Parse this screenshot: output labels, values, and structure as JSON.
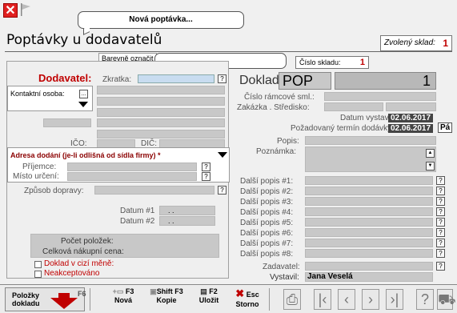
{
  "top": {
    "new_request_callout": "Nová poptávka..."
  },
  "page_title": "Poptávky u dodavatelů",
  "sklad_label": "Zvolený sklad:",
  "sklad_value": "1",
  "barevne_oznacit": "Barevně označit",
  "cislo_skladu_label": "Číslo skladu:",
  "cislo_skladu_value": "1",
  "left": {
    "dodavatel": "Dodavatel:",
    "zkratka": "Zkratka:",
    "kontaktni_osoba": "Kontaktní osoba:",
    "ico": "IČO:",
    "dic": "DIČ:",
    "adresa_title": "Adresa dodání (je-li odlišná od sídla firmy) *",
    "prijemce": "Příjemce:",
    "misto_urceni": "Místo určení:",
    "zpusob_dopravy": "Způsob dopravy:",
    "datum1": "Datum #1",
    "datum2": "Datum #2",
    "datum1_value": ". .",
    "datum2_value": ". .",
    "pocet_polozek": "Počet položek:",
    "celkova_cena": "Celková nákupní cena:",
    "doklad_cizi_mene": "Doklad v cizí měně:",
    "neakceptovano": "Neakceptováno"
  },
  "right": {
    "doklad": "Doklad:",
    "doklad_type": "POP",
    "doklad_number": "1",
    "cislo_ramcove": "Číslo rámcové sml.:",
    "zakazka": "Zakázka . Středisko:",
    "datum_vystaveni": "Datum vystavení:",
    "datum_vystaveni_value": "02.06.2017",
    "pozadovany_termin": "Požadovaný termín dodávky:",
    "pozadovany_termin_value": "02.06.2017",
    "pa_button": "Pá",
    "popis": "Popis:",
    "poznamka": "Poznámka:",
    "dalsi_popis": [
      "Další popis #1:",
      "Další popis #2:",
      "Další popis #3:",
      "Další popis #4:",
      "Další popis #5:",
      "Další popis #6:",
      "Další popis #7:",
      "Další popis #8:"
    ],
    "zadavatel": "Zadavatel:",
    "vystavil": "Vystavil:",
    "vystavil_value": "Jana Veselá"
  },
  "toolbar": {
    "polozky": "Položky",
    "dokladu": "dokladu",
    "polozky_key": "F6",
    "nova_key": "F3",
    "nova": "Nová",
    "kopie_key": "Shift F3",
    "kopie": "Kopie",
    "ulozit_key": "F2",
    "ulozit": "Uložit",
    "storno_key": "Esc",
    "storno": "Storno"
  },
  "colors": {
    "accent_red": "#c00000",
    "field_gray": "#c8c8c8",
    "field_blue": "#c8dcf0"
  }
}
